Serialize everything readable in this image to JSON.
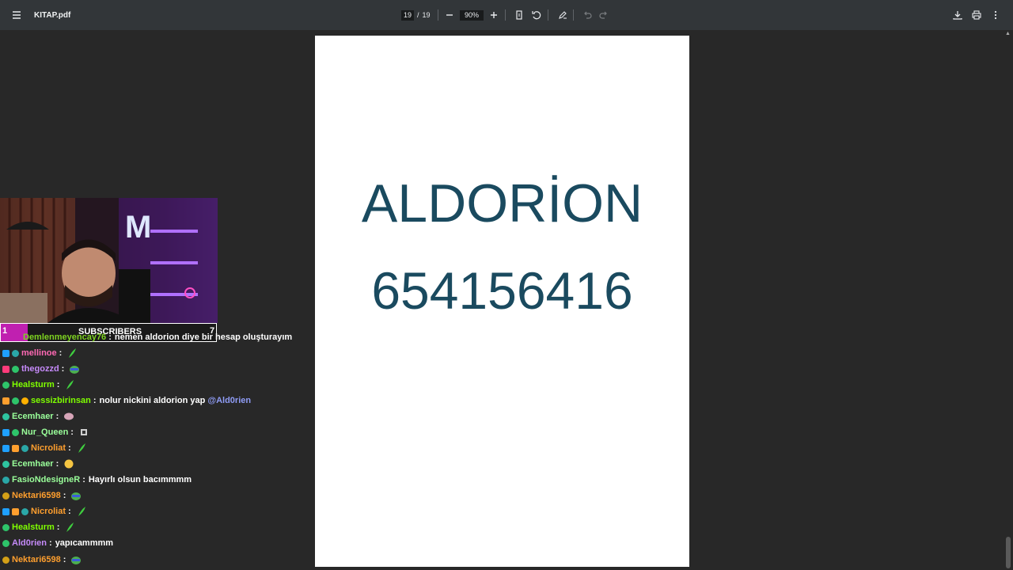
{
  "toolbar": {
    "title": "KITAP.pdf",
    "page_current": "19",
    "page_sep": "/",
    "page_total": "19",
    "zoom": "90%"
  },
  "document": {
    "lines": [
      "ALDORİON",
      "654156416"
    ],
    "text_color": "#1a4a5f"
  },
  "overlay": {
    "subscriber_left": "1",
    "subscriber_label": "SUBSCRIBERS",
    "subscriber_right": "7"
  },
  "chat": [
    {
      "user": "Demlenmeyencay76",
      "color": "#7ed321",
      "text": "nemen aldorion diye bir hesap oluşturayım",
      "emote": ""
    },
    {
      "user": "mellinoe",
      "color": "#ff69b4",
      "text": "",
      "emote": "feather"
    },
    {
      "user": "thegozzd",
      "color": "#c58af9",
      "text": "",
      "emote": "frog"
    },
    {
      "user": "Healsturm",
      "color": "#7fff00",
      "text": "",
      "emote": "feather"
    },
    {
      "user": "sessizbirinsan",
      "color": "#7fff00",
      "text": "nolur nickini aldorion yap",
      "emote": "",
      "mention": "@Ald0rien"
    },
    {
      "user": "Ecemhaer",
      "color": "#9aff9a",
      "text": "",
      "emote": "brain"
    },
    {
      "user": "Nur_Queen",
      "color": "#9aff9a",
      "text": "",
      "emote": "sticker"
    },
    {
      "user": "Nicroliat",
      "color": "#ff9f2e",
      "text": "",
      "emote": "feather"
    },
    {
      "user": "Ecemhaer",
      "color": "#9aff9a",
      "text": "",
      "emote": "hands"
    },
    {
      "user": "FasioNdesigneR",
      "color": "#9aff9a",
      "text": "Hayırlı olsun bacımmmm",
      "emote": ""
    },
    {
      "user": "Nektari6598",
      "color": "#ff9f2e",
      "text": "",
      "emote": "frog"
    },
    {
      "user": "Nicroliat",
      "color": "#ff9f2e",
      "text": "",
      "emote": "feather"
    },
    {
      "user": "Healsturm",
      "color": "#7fff00",
      "text": "",
      "emote": "feather"
    },
    {
      "user": "Ald0rien",
      "color": "#c58af9",
      "text": "yapıcammmm",
      "emote": ""
    },
    {
      "user": "Nektari6598",
      "color": "#ff9f2e",
      "text": "",
      "emote": "frog"
    }
  ]
}
